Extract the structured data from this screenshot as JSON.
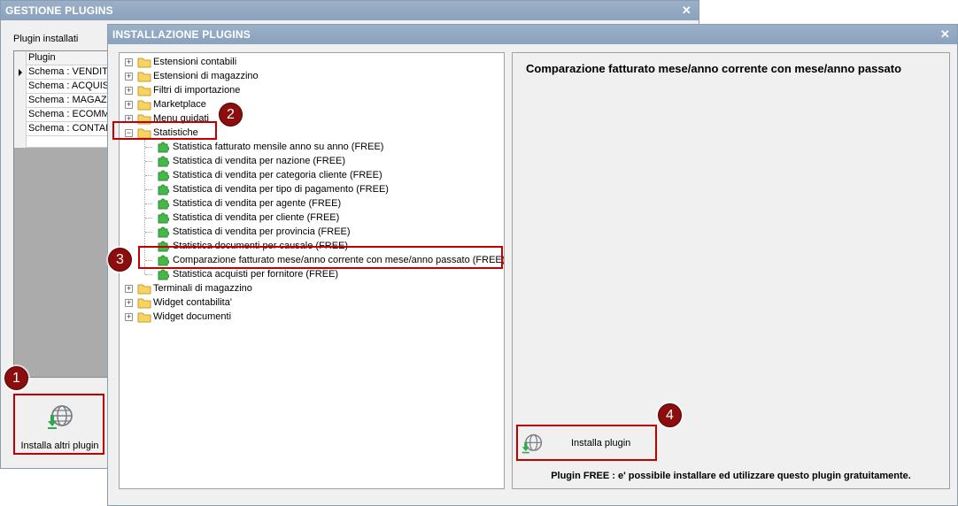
{
  "back_window": {
    "title": "GESTIONE PLUGINS",
    "close": "✕",
    "installed_label": "Plugin installati",
    "grid_header": "Plugin",
    "grid_rows": [
      "Schema : VENDITE",
      "Schema : ACQUISTI",
      "Schema : MAGAZZINO",
      "Schema : ECOMMERCE",
      "Schema : CONTABILITA"
    ],
    "install_button_label": "Installa altri plugin"
  },
  "front_window": {
    "title": "INSTALLAZIONE PLUGINS",
    "close": "✕",
    "tree": {
      "top_folders": [
        "Estensioni contabili",
        "Estensioni di magazzino",
        "Filtri di importazione",
        "Marketplace",
        "Menu guidati"
      ],
      "open_folder": "Statistiche",
      "leaves": [
        "Statistica fatturato mensile anno su anno (FREE)",
        "Statistica di vendita per nazione (FREE)",
        "Statistica di vendita per categoria cliente (FREE)",
        "Statistica di vendita per tipo di pagamento (FREE)",
        "Statistica di vendita per agente (FREE)",
        "Statistica di vendita per cliente (FREE)",
        "Statistica di vendita per provincia (FREE)",
        "Statistica documenti per causale (FREE)",
        "Comparazione fatturato mese/anno corrente con mese/anno passato (FREE)",
        "Statistica acquisti per fornitore (FREE)"
      ],
      "bottom_folders": [
        "Terminali di magazzino",
        "Widget contabilita'",
        "Widget documenti"
      ]
    },
    "detail": {
      "title": "Comparazione fatturato mese/anno corrente con mese/anno passato",
      "install_button_label": "Installa plugin",
      "note": "Plugin FREE : e' possibile installare ed utilizzare questo plugin gratuitamente."
    }
  },
  "callouts": [
    "1",
    "2",
    "3",
    "4"
  ],
  "colors": {
    "titlebar": "#8aa2bd",
    "annotation_red": "#c00000",
    "callout_fill": "#8b0d0d"
  }
}
